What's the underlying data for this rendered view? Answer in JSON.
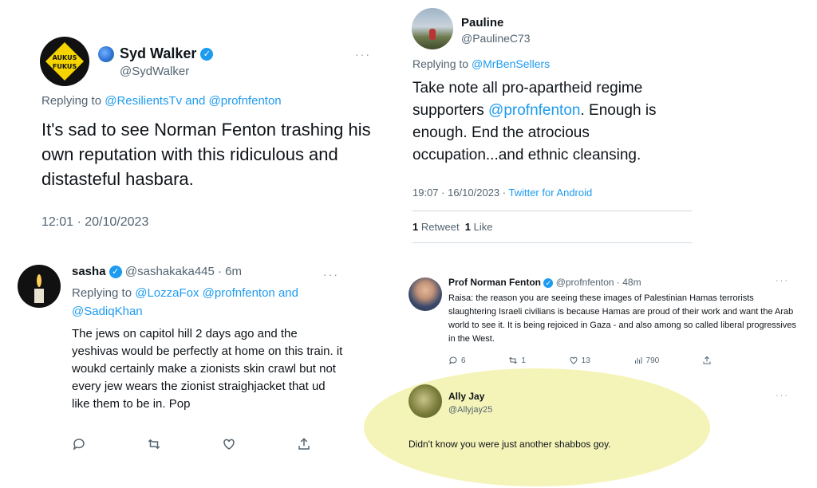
{
  "tweet_syd": {
    "name": "Syd Walker",
    "handle": "@SydWalker",
    "avatar_text_top": "AUKUS",
    "avatar_text_bottom": "FUKUS",
    "replying_prefix": "Replying to ",
    "replying_user1": "@ResilientsTv",
    "replying_and": " and ",
    "replying_user2": "@profnfenton",
    "body": "It's sad to see Norman Fenton trashing his own reputation with this ridiculous and distasteful hasbara.",
    "timestamp": "12:01 · 20/10/2023"
  },
  "tweet_pauline": {
    "name": "Pauline",
    "handle": "@PaulineC73",
    "replying_prefix": "Replying to ",
    "replying_user": "@MrBenSellers",
    "body_part1": "Take note all pro-apartheid regime supporters ",
    "body_mention": "@profnfenton",
    "body_part2": ". Enough is enough. End the atrocious occupation...and ethnic cleansing.",
    "timestamp": "19:07 · 16/10/2023 · ",
    "client": "Twitter for Android",
    "retweet_count": "1",
    "retweet_label": "Retweet",
    "like_count": "1",
    "like_label": "Like"
  },
  "tweet_sasha": {
    "name": "sasha",
    "handle_time": "@sashakaka445 · 6m",
    "replying_prefix": "Replying to ",
    "replying_user1": "@LozzaFox",
    "replying_user2": "@profnfenton",
    "replying_and": " and",
    "replying_user3": "@SadiqKhan",
    "body": "The jews on capitol hill 2 days ago and the yeshivas would be perfectly at home on this train. it woukd certainly make a zionists skin crawl but not every jew wears the zionist straighjacket that ud like them to be in. Pop"
  },
  "tweet_fenton": {
    "name": "Prof Norman Fenton",
    "handle_time": "@profnfenton · 48m",
    "body": "Raisa: the reason you are seeing these images of Palestinian Hamas terrorists slaughtering Israeli civilians is because Hamas are proud of their work and want the Arab world to see it. It is  being rejoiced in Gaza - and also among so called liberal progressives in the West.",
    "replies": "6",
    "retweets": "1",
    "likes": "13",
    "views": "790"
  },
  "tweet_ally": {
    "name": "Ally Jay",
    "handle": "@Allyjay25",
    "body": "Didn't know you were just another shabbos goy."
  },
  "more_symbol": "···",
  "colors": {
    "accent": "#1d9bf0",
    "secondary_text": "#536471",
    "highlight": "#f4f3b4"
  }
}
